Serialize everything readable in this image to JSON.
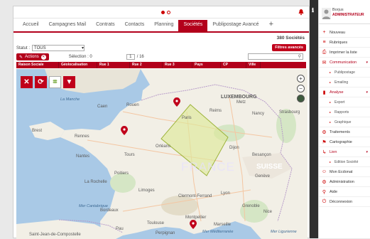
{
  "menu": {
    "items": [
      "Accueil",
      "Campagnes Mail",
      "Contrats",
      "Contacts",
      "Planning",
      "Sociétés",
      "Publipostage Avancé"
    ],
    "active": "Sociétés",
    "add": "+"
  },
  "summary": {
    "count": "380 Sociétés"
  },
  "status": {
    "label": "Statut :",
    "value": "TOUS"
  },
  "filters_button": "Filtres avancés",
  "toolbar": {
    "actions": "Actions",
    "selection": "Sélection : 0",
    "page": "1",
    "total_pages": "/ 16",
    "search_icon": "search-icon"
  },
  "columns": [
    "Raison Sociale",
    "Géolocalisation",
    "Rue 1",
    "Rue 2",
    "Rue 3",
    "Pays",
    "CP",
    "Ville"
  ],
  "map": {
    "labels": {
      "france": "FRANCE",
      "suisse": "SUISSE",
      "luxembourg": "LUXEMBOURG",
      "la_manche": "La Manche",
      "mer_cantabrique": "Mer Cantabrique",
      "mer_ligurienne": "Mer Ligurienne",
      "mer_mediterranee": "Mer Méditerranée",
      "rennes": "Rennes",
      "nantes": "Nantes",
      "paris": "Paris",
      "rouen": "Rouen",
      "caen": "Caen",
      "orleans": "Orléans",
      "tours": "Tours",
      "poitiers": "Poitiers",
      "limoges": "Limoges",
      "dijon": "Dijon",
      "lyon": "Lyon",
      "bordeaux": "Bordeaux",
      "toulouse": "Toulouse",
      "montpellier": "Montpellier",
      "marseille": "Marseille",
      "nice": "Nice",
      "reims": "Reims",
      "strasbourg": "Strasbourg",
      "grenoble": "Grenoble",
      "geneve": "Genève",
      "clermont": "Clermont-Ferrand",
      "brest": "Brest",
      "la_rochelle": "La Rochelle",
      "metz": "Metz",
      "nancy": "Nancy",
      "besancon": "Besançon",
      "pau": "Pau",
      "perpignan": "Perpignan",
      "saint_jean": "Saint-Jean-de-Compostelle"
    }
  },
  "user": {
    "name": "Borjus",
    "role": "ADMINISTRATEUR"
  },
  "sidebar": {
    "items": [
      {
        "label": "Nouveau",
        "icon": "plus-icon",
        "sub": false
      },
      {
        "label": "Rubriques",
        "icon": "list-icon",
        "sub": false
      },
      {
        "label": "Imprimer la liste",
        "icon": "print-icon",
        "sub": false
      },
      {
        "label": "Communication",
        "icon": "mail-icon",
        "sub": false,
        "open": true
      },
      {
        "label": "Publipostage",
        "icon": "bullet-icon",
        "sub": true
      },
      {
        "label": "Emailing",
        "icon": "bullet-icon",
        "sub": true
      },
      {
        "label": "Analyse",
        "icon": "chart-icon",
        "sub": false,
        "open": true
      },
      {
        "label": "Export",
        "icon": "bullet-icon",
        "sub": true
      },
      {
        "label": "Rapports",
        "icon": "bullet-icon",
        "sub": true
      },
      {
        "label": "Graphique",
        "icon": "bullet-icon",
        "sub": true
      },
      {
        "label": "Traitements",
        "icon": "gear-icon",
        "sub": false
      },
      {
        "label": "Cartographie",
        "icon": "map-pin-icon",
        "sub": false
      },
      {
        "label": "Lien",
        "icon": "link-icon",
        "sub": false,
        "open": true
      },
      {
        "label": "Edition Société",
        "icon": "bullet-icon",
        "sub": true
      },
      {
        "label": "Mon Ecdonat",
        "icon": "user-icon",
        "sub": false
      },
      {
        "label": "Administration",
        "icon": "gears-icon",
        "sub": false
      },
      {
        "label": "Aide",
        "icon": "pin-icon",
        "sub": false
      },
      {
        "label": "Déconnexion",
        "icon": "power-icon",
        "sub": false
      }
    ]
  }
}
